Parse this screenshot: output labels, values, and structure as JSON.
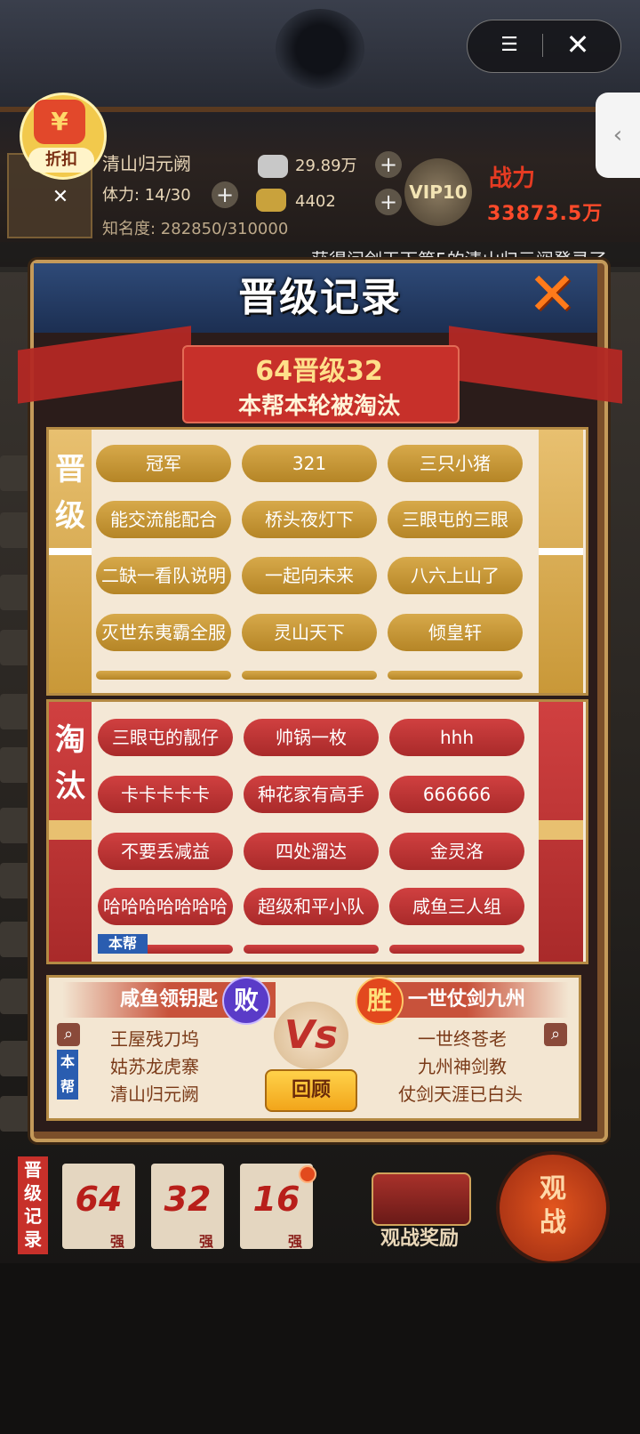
{
  "header": {
    "player_name": "清山归元阙",
    "stamina": "体力: 14/30",
    "fame": "知名度: 282850/310000",
    "silver": "29.89万",
    "gold": "4402",
    "vip": "VIP10",
    "power_label": "战力",
    "power_value": "33873.5万",
    "discount_label": "折扣",
    "marquee": "获得问剑天下第5的清山归元阙登录了"
  },
  "modal": {
    "title": "晋级记录",
    "round": "64晋级32",
    "result": "本帮本轮被淘汰",
    "advance_label": "晋级",
    "eliminated_label": "淘汰",
    "own_guild_badge": "本帮",
    "advanced": [
      "冠军",
      "321",
      "三只小猪",
      "能交流能配合",
      "桥头夜灯下",
      "三眼屯的三眼",
      "二缺一看队说明",
      "一起向未来",
      "八六上山了",
      "灭世东夷霸全服",
      "灵山天下",
      "倾皇轩"
    ],
    "eliminated": [
      "三眼屯的靓仔",
      "帅锅一枚",
      "hhh",
      "卡卡卡卡卡",
      "种花家有高手",
      "666666",
      "不要丢减益",
      "四处溜达",
      "金灵洛",
      "哈哈哈哈哈哈哈",
      "超级和平小队",
      "咸鱼三人组"
    ]
  },
  "match": {
    "left_team": "咸鱼领钥匙",
    "left_result": "败",
    "left_members": [
      "王屋残刀坞",
      "姑苏龙虎寨",
      "清山归元阙"
    ],
    "own_tag": "本帮",
    "vs": "Vs",
    "right_team": "一世仗剑九州",
    "right_result": "胜",
    "right_members": [
      "一世终苍老",
      "九州神剑教",
      "仗剑天涯已白头"
    ],
    "review_button": "回顾"
  },
  "bottom": {
    "progress_label": "晋级记录",
    "rounds": [
      {
        "num": "64",
        "unit": "强"
      },
      {
        "num": "32",
        "unit": "强"
      },
      {
        "num": "16",
        "unit": "强"
      }
    ],
    "reward_label": "观战奖励",
    "watch_label": "观战"
  }
}
